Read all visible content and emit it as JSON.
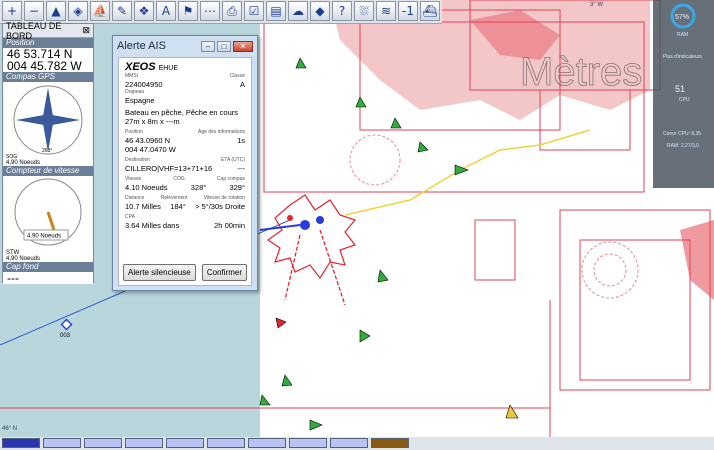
{
  "toolbar": {
    "icons": [
      "zoom-in",
      "zoom-out",
      "north-up",
      "compass",
      "route",
      "measure",
      "mob",
      "text-annotation",
      "waypoint-mark",
      "track",
      "print",
      "chart-settings",
      "layers",
      "weather",
      "ais",
      "help",
      "tide",
      "current",
      "scale-down",
      "boat"
    ],
    "glyphs": [
      "+",
      "−",
      "▲",
      "◈",
      "⛵",
      "✎",
      "❖",
      "A",
      "⚑",
      "⋯",
      "⎙",
      "☑",
      "▤",
      "☁",
      "◆",
      "?",
      "⛆",
      "≋",
      "-1",
      "⛴"
    ]
  },
  "dashboard": {
    "title": "TABLEAU DE BORD",
    "close": "⊠",
    "position_label": "Position",
    "lat": "46 53.714 N",
    "lon": "004 45.782 W",
    "gps_label": "Compas GPS",
    "cog_small": "SOG",
    "sog_small": "4.90 Noeuds",
    "heading_readout": "263°",
    "speed_label": "Compteur de vitesse",
    "speed_value": "4.90 Noeuds",
    "stw_label": "STW",
    "stw_value": "4.90 Noeuds",
    "capfond_label": "Cap fond",
    "capfond_value": "---"
  },
  "alert": {
    "title": "Alerte AIS",
    "vessel_name": "XEOS",
    "callsign": "EHUE",
    "mmsi_label": "MMSI",
    "mmsi": "224004950",
    "class_label": "Classe",
    "class_value": "A",
    "flag_label": "Drapeau",
    "flag": "Espagne",
    "type": "Bateau en pêche, Pêche en cours",
    "dims": "27m x 8m x ---m",
    "position_label": "Position",
    "age_label": "Age des informations",
    "lat": "46 43.0960 N",
    "lon": "004 47.0470 W",
    "age": "1s",
    "dest_label": "Destination",
    "eta_label": "ETA (UTC)",
    "destination": "CILLERO|VHF=13+71+16",
    "eta": "---",
    "vit_label": "Vitesse",
    "cog_label": "COG",
    "cap_label": "Cap compas",
    "speed": "4.10 Noeuds",
    "cog": "328°",
    "cap": "329°",
    "dist_label": "Distance",
    "brg_label": "Relèvement",
    "rot_label": "Vitesse de rotation",
    "distance": "10.7 Milles",
    "bearing": "184°",
    "rot": "> 5°/30s Droite",
    "cpa_label": "CPA",
    "cpa": "3.64 Milles dans",
    "tcpa": "2h 00min",
    "btn_silence": "Alerte silencieuse",
    "btn_confirm": "Confirmer"
  },
  "chart": {
    "overlay_text": "Mètres",
    "mark_003": "003",
    "lat_46": "46° N",
    "w3": "3° W",
    "sea_color": "#b9d6dc",
    "land_color": "#f6d4d4"
  },
  "sysmon": {
    "cpu_pct": "57%",
    "ram_label": "RAM",
    "detail": "Plus d'indicateurs",
    "cpu_val": "51",
    "cpu_label": "CPU",
    "core": "Coeur CPU: 8,35",
    "ram": "RAM: 2,27/3,0"
  }
}
